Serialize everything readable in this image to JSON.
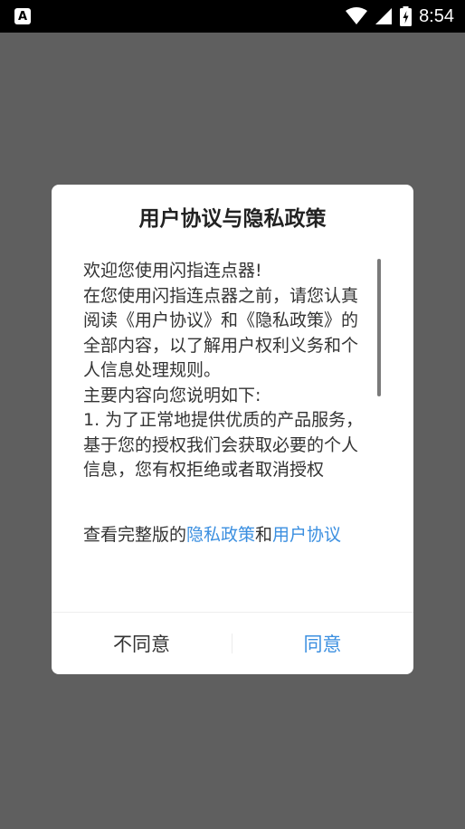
{
  "status_bar": {
    "notification_icon": "A",
    "time": "8:54"
  },
  "dialog": {
    "title": "用户协议与隐私政策",
    "body": "欢迎您使用闪指连点器!\n在您使用闪指连点器之前，请您认真阅读《用户协议》和《隐私政策》的全部内容，以了解用户权利义务和个人信息处理规则。\n主要内容向您说明如下:\n1. 为了正常地提供优质的产品服务，基于您的授权我们会获取必要的个人信息，您有权拒绝或者取消授权",
    "view_full_prefix": "查看完整版的",
    "privacy_link": "隐私政策",
    "and_text": "和",
    "agreement_link": "用户协议",
    "disagree_label": "不同意",
    "agree_label": "同意"
  },
  "colors": {
    "accent": "#3b8fe0",
    "overlay": "#5f5f5f"
  }
}
